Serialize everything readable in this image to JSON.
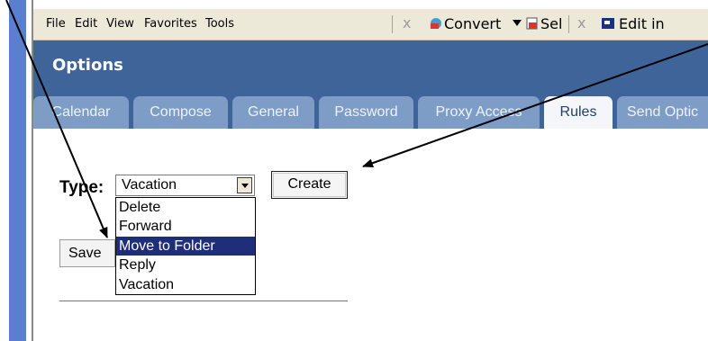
{
  "menubar": {
    "items": [
      "File",
      "Edit",
      "View",
      "Favorites",
      "Tools"
    ],
    "toolbar": {
      "convert_label": "Convert",
      "select_label": "Sel",
      "edit_label": "Edit in",
      "close_glyph": "x"
    }
  },
  "header": {
    "title": "Options"
  },
  "tabs": [
    {
      "label": "Calendar",
      "active": false
    },
    {
      "label": "Compose",
      "active": false
    },
    {
      "label": "General",
      "active": false
    },
    {
      "label": "Password",
      "active": false
    },
    {
      "label": "Proxy Access",
      "active": false
    },
    {
      "label": "Rules",
      "active": true
    },
    {
      "label": "Send Optic",
      "active": false
    }
  ],
  "rules": {
    "type_label": "Type:",
    "selected_value": "Vacation",
    "options": [
      "Delete",
      "Forward",
      "Move to Folder",
      "Reply",
      "Vacation"
    ],
    "highlighted_option": "Move to Folder",
    "create_label": "Create",
    "save_label": "Save"
  },
  "colors": {
    "header_bg": "#3f649a",
    "tab_bg": "#7d9cc6",
    "active_tab_bg": "#f4f6f9",
    "selection_bg": "#1f2e78"
  }
}
